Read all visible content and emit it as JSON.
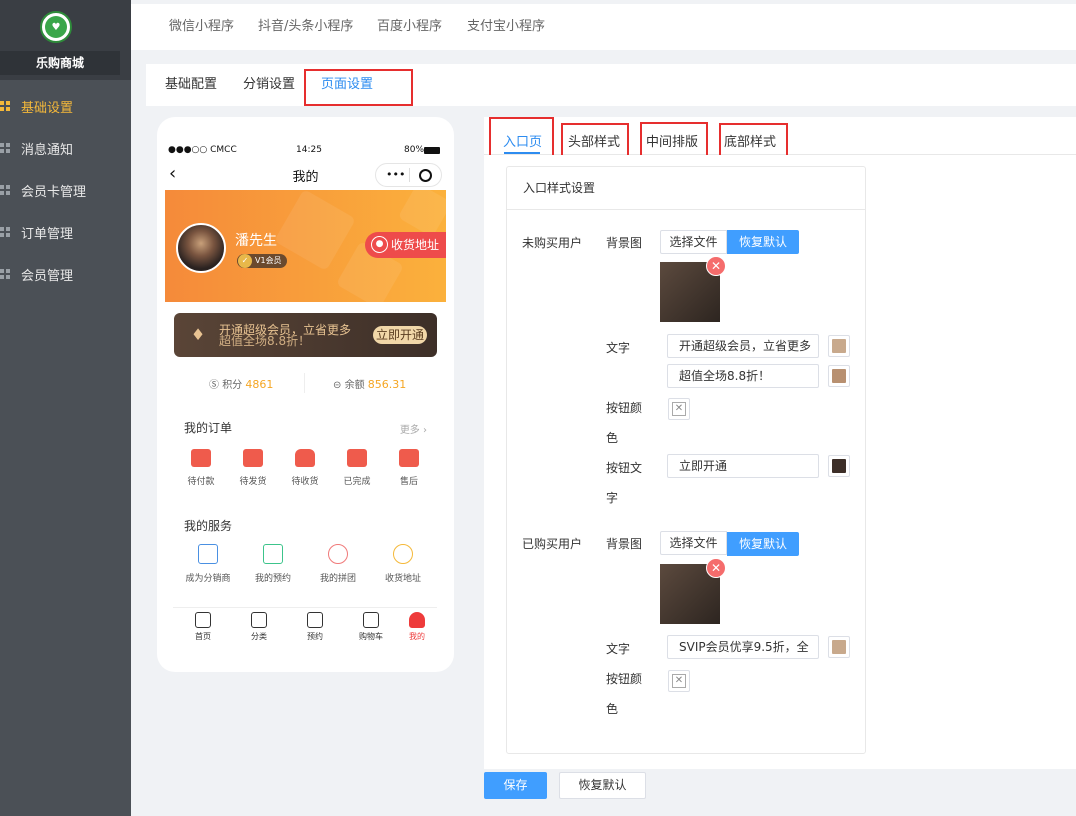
{
  "sidebar": {
    "shop_name": "乐购商城",
    "items": [
      {
        "label": "基础设置",
        "active": true
      },
      {
        "label": "消息通知",
        "active": false
      },
      {
        "label": "会员卡管理",
        "active": false
      },
      {
        "label": "订单管理",
        "active": false
      },
      {
        "label": "会员管理",
        "active": false
      }
    ]
  },
  "top_tabs": [
    "微信小程序",
    "抖音/头条小程序",
    "百度小程序",
    "支付宝小程序"
  ],
  "sub_tabs": [
    {
      "label": "基础配置",
      "active": false
    },
    {
      "label": "分销设置",
      "active": false
    },
    {
      "label": "页面设置",
      "active": true
    }
  ],
  "phone": {
    "status": {
      "carrier": "●●●○○ CMCC",
      "time": "14:25",
      "battery": "80%"
    },
    "nav_title": "我的",
    "capsule_dots": "•••",
    "user_name": "潘先生",
    "vip_level": "V1会员",
    "address_btn": "收货地址",
    "vip_card": {
      "line1": "开通超级会员，立省更多",
      "line2": "超值全场8.8折！",
      "button": "立即开通"
    },
    "points": {
      "label": "积分",
      "value": "4861"
    },
    "balance": {
      "label": "余额",
      "value": "856.31"
    },
    "orders": {
      "title": "我的订单",
      "more": "更多",
      "items": [
        "待付款",
        "待发货",
        "待收货",
        "已完成",
        "售后"
      ]
    },
    "services": {
      "title": "我的服务",
      "items": [
        "成为分销商",
        "我的预约",
        "我的拼团",
        "收货地址"
      ]
    },
    "tabbar": [
      {
        "label": "首页",
        "active": false
      },
      {
        "label": "分类",
        "active": false
      },
      {
        "label": "预约",
        "active": false
      },
      {
        "label": "购物车",
        "active": false
      },
      {
        "label": "我的",
        "active": true
      }
    ]
  },
  "panel": {
    "tabs": [
      {
        "label": "入口页",
        "active": true
      },
      {
        "label": "头部样式",
        "active": false
      },
      {
        "label": "中间排版",
        "active": false
      },
      {
        "label": "底部样式",
        "active": false
      }
    ],
    "box_title": "入口样式设置",
    "unbought": {
      "group_label": "未购买用户",
      "bg_label": "背景图",
      "choose_file": "选择文件",
      "restore_default": "恢复默认",
      "text_label": "文字",
      "text1": "开通超级会员，立省更多",
      "text2": "超值全场8.8折！",
      "text1_color": "#c8a98c",
      "text2_color": "#b89070",
      "btn_color_label1": "按钮颜",
      "btn_color_label2": "色",
      "btn_text_label1": "按钮文",
      "btn_text_label2": "字",
      "btn_text": "立即开通",
      "btn_text_color": "#3d2f28"
    },
    "bought": {
      "group_label": "已购买用户",
      "bg_label": "背景图",
      "choose_file": "选择文件",
      "restore_default": "恢复默认",
      "text_label": "文字",
      "text1": "SVIP会员优享9.5折，全",
      "text1_color": "#c8a98c",
      "btn_color_label1": "按钮颜",
      "btn_color_label2": "色"
    }
  },
  "footer": {
    "save": "保存",
    "reset": "恢复默认"
  }
}
